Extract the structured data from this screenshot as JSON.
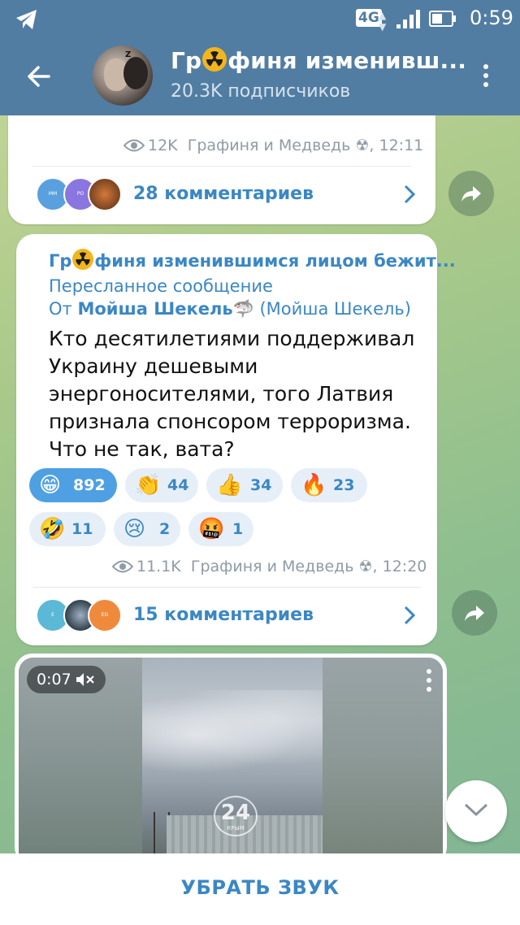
{
  "status_bar": {
    "network": "4G",
    "time": "0:59"
  },
  "header": {
    "title_prefix": "Гр",
    "title_suffix": "финя изменивш...",
    "subtitle": "20.3K подписчиков"
  },
  "post1": {
    "views": "12K",
    "author": "Графиня и Медведь",
    "time": "12:11",
    "comments_label": "28 комментариев",
    "commenters": [
      "MM",
      "PO",
      "fox"
    ]
  },
  "post2": {
    "channel_prefix": "Гр",
    "channel_suffix": "финя изменившимся лицом бежит...",
    "forwarded_label": "Пересланное сообщение",
    "from_prefix": "От ",
    "from_name": "Мойша Шекель",
    "from_paren": "(Мойша Шекель)",
    "text": "Кто десятилетиями поддерживал Украину дешевыми энергоносителями, того Латвия признала спонсором терроризма. Что не так, вата?",
    "reactions": [
      {
        "emoji": "😁",
        "count": "892",
        "active": true
      },
      {
        "emoji": "👏",
        "count": "44"
      },
      {
        "emoji": "👍",
        "count": "34"
      },
      {
        "emoji": "🔥",
        "count": "23"
      },
      {
        "emoji": "🤣",
        "count": "11"
      },
      {
        "emoji": "😢",
        "count": "2"
      },
      {
        "emoji": "🤬",
        "count": "1"
      }
    ],
    "views": "11.1K",
    "author": "Графиня и Медведь",
    "time": "12:20",
    "comments_label": "15 комментариев",
    "commenters": [
      "E",
      "img",
      "EG"
    ]
  },
  "video": {
    "duration": "0:07",
    "logo_number": "24",
    "logo_caption": "КРЫМ"
  },
  "bottom_action": "УБРАТЬ ЗВУК",
  "colors": {
    "header": "#527da3",
    "accent": "#3b87c4",
    "reaction_active": "#4fa0e3",
    "reaction_bg": "#e6eff8",
    "radiation": "#f2b51b"
  },
  "icons": [
    "telegram-icon",
    "back-arrow-icon",
    "more-vert-icon",
    "radiation-icon",
    "eye-icon",
    "chevron-right-icon",
    "share-icon",
    "mute-icon",
    "chevron-down-icon"
  ]
}
